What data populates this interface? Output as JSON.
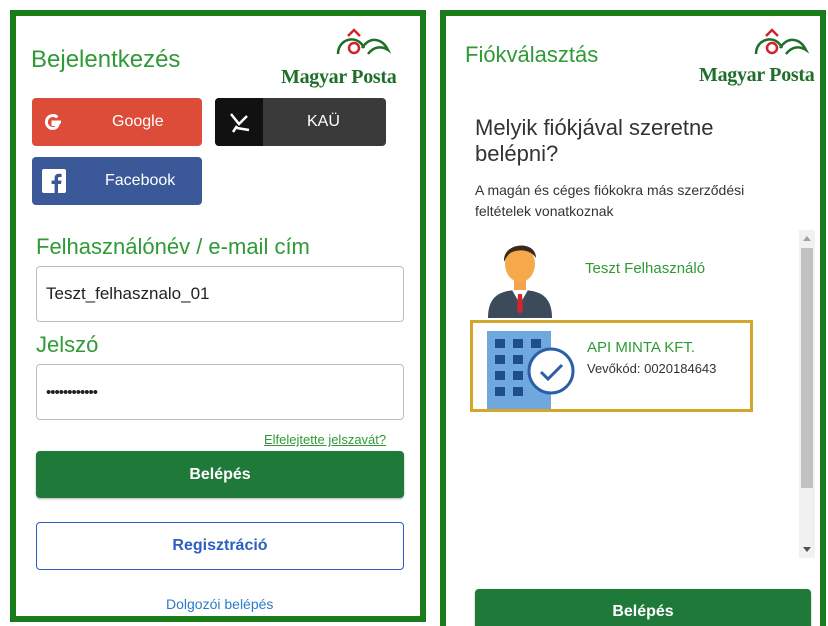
{
  "left": {
    "title": "Bejelentkezés",
    "logo_text": "Magyar Posta",
    "social": {
      "google": "Google",
      "kau": "KAÜ",
      "facebook": "Facebook"
    },
    "username_label": "Felhasználónév / e-mail cím",
    "username_value": "Teszt_felhasznalo_01",
    "password_label": "Jelszó",
    "password_value": "••••••••••••",
    "forgot_link": "Elfelejtette jelszavát?",
    "login_button": "Belépés",
    "register_button": "Regisztráció",
    "employee_link": "Dolgozói belépés"
  },
  "right": {
    "title": "Fiókválasztás",
    "logo_text": "Magyar Posta",
    "question": "Melyik fiókjával szeretne belépni?",
    "description": "A magán és céges fiókokra más szerződési feltételek vonatkoznak",
    "accounts": [
      {
        "name": "Teszt Felhasználó",
        "selected": false
      },
      {
        "name": "API MINTA KFT.",
        "sub": "Vevőkód: 0020184643",
        "selected": true
      }
    ],
    "login_button": "Belépés"
  },
  "colors": {
    "brand_green": "#1a7d1a",
    "text_green": "#2f9a36",
    "button_green": "#1f7a3a",
    "google_red": "#dd4b39",
    "facebook_blue": "#3b5998",
    "kau_dark": "#3a3a3a",
    "selected_border": "#d4a72c",
    "link_blue": "#2c7cc9"
  }
}
